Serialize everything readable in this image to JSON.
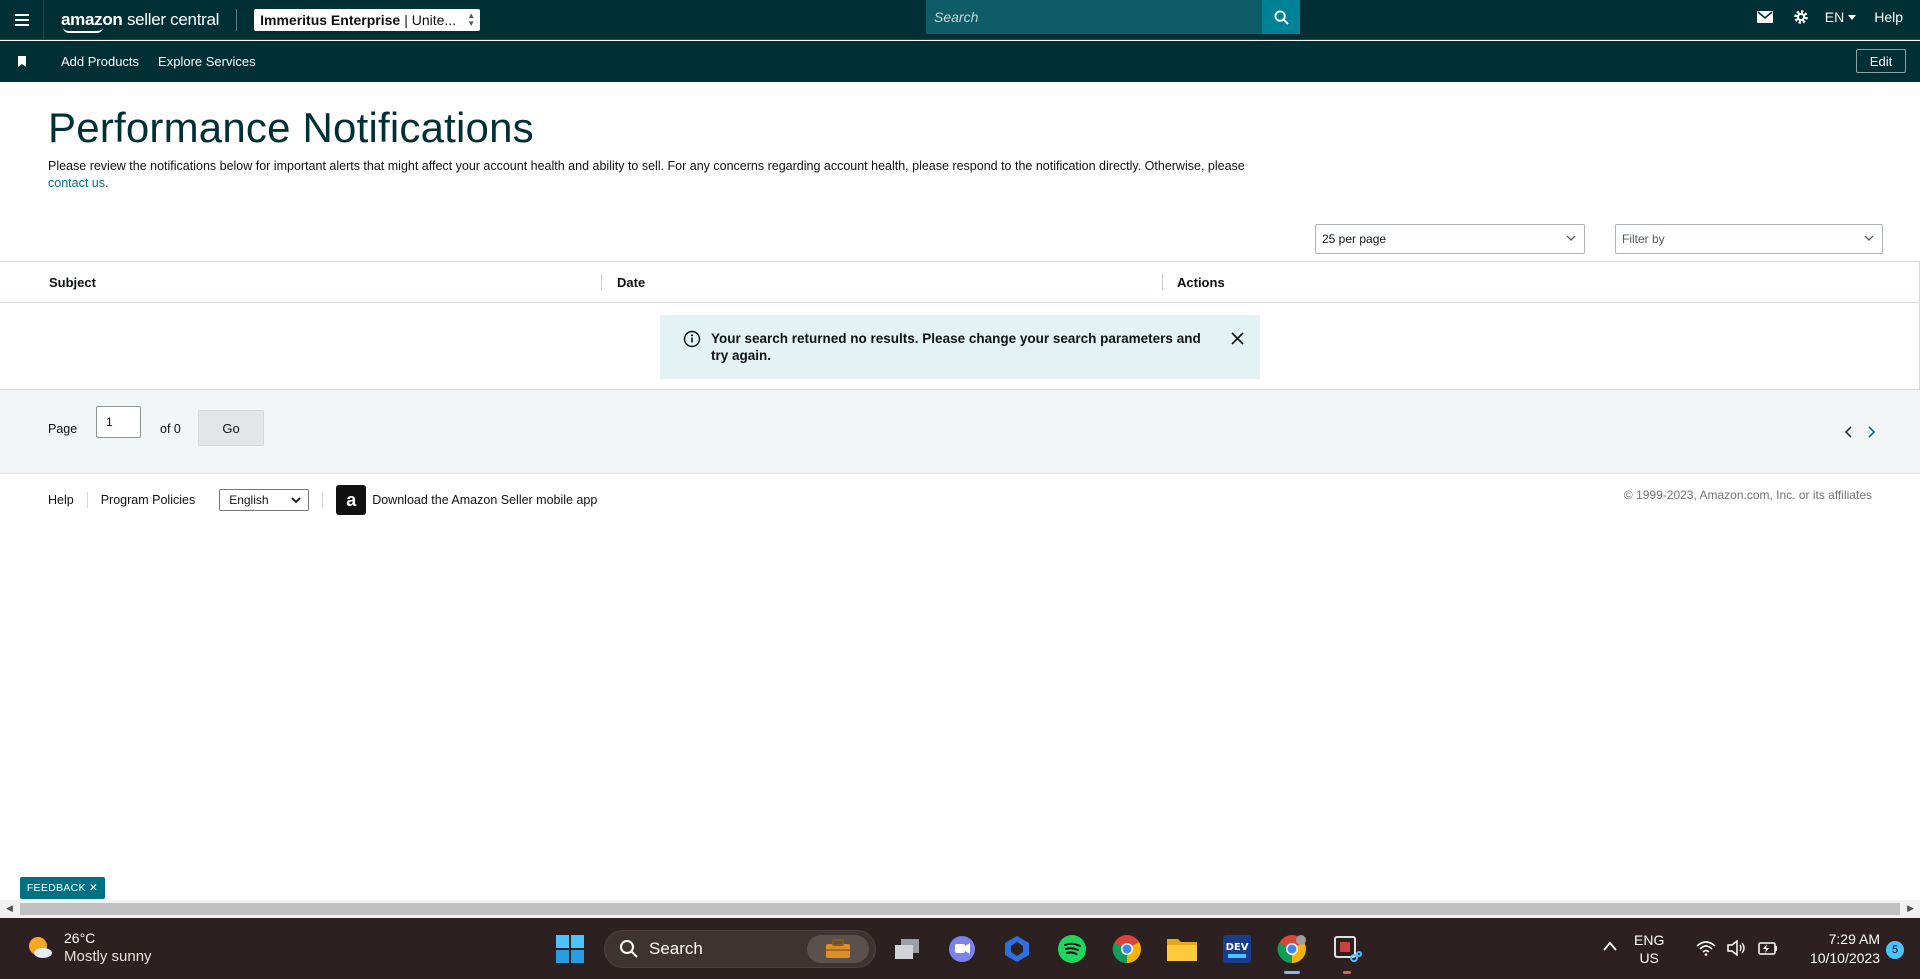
{
  "topbar": {
    "logo_brand": "amazon",
    "logo_rest": "seller central",
    "account_name": "Immeritus Enterprise",
    "account_region": "| Unite...",
    "search_placeholder": "Search",
    "language": "EN",
    "help": "Help"
  },
  "subbar": {
    "links": [
      "Add Products",
      "Explore Services"
    ],
    "edit": "Edit"
  },
  "page": {
    "title": "Performance Notifications",
    "description": "Please review the notifications below for important alerts that might affect your account health and ability to sell. For any concerns regarding account health, please respond to the notification directly. Otherwise, please",
    "contact_link": "contact us",
    "contact_suffix": "."
  },
  "controls": {
    "per_page": "25 per page",
    "filter_placeholder": "Filter by"
  },
  "table": {
    "columns": [
      "Subject",
      "Date",
      "Actions"
    ],
    "empty_message": "Your search returned no results. Please change your search parameters and try again."
  },
  "pager": {
    "page_label": "Page",
    "current_page": "1",
    "of_label": "of 0",
    "go": "Go"
  },
  "footer": {
    "help": "Help",
    "program_policies": "Program Policies",
    "language": "English",
    "app_download": "Download the Amazon Seller mobile app",
    "copyright": "© 1999-2023, Amazon.com, Inc. or its affiliates"
  },
  "feedback": "FEEDBACK",
  "taskbar": {
    "temperature": "26°C",
    "weather": "Mostly sunny",
    "search": "Search",
    "lang_line1": "ENG",
    "lang_line2": "US",
    "time": "7:29 AM",
    "date": "10/10/2023",
    "notifications": "5"
  },
  "colors": {
    "header_bg": "#002f36",
    "search_btn": "#008296",
    "link": "#007185",
    "alert_bg": "#e3f2f2",
    "taskbar_bg": "#2c2120"
  }
}
